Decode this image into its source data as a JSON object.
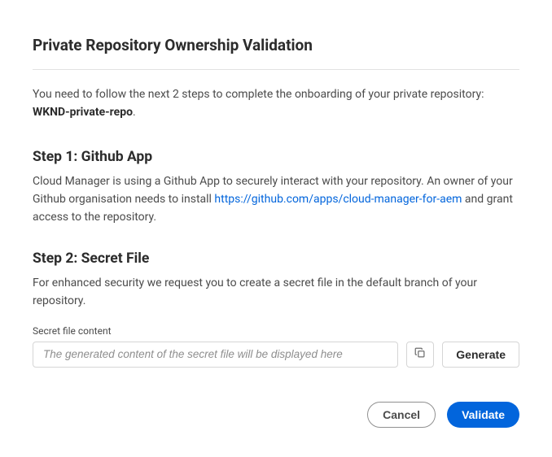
{
  "title": "Private Repository Ownership Validation",
  "intro": {
    "prefix": "You need to follow the next 2 steps to complete the onboarding of your private repository: ",
    "repo_name": "WKND-private-repo",
    "suffix": "."
  },
  "step1": {
    "heading": "Step 1: Github App",
    "body_prefix": "Cloud Manager is using a Github App to securely interact with your repository. An owner of your Github organisation needs to install ",
    "link_text": "https://github.com/apps/cloud-manager-for-aem",
    "body_suffix": " and grant access to the repository."
  },
  "step2": {
    "heading": "Step 2: Secret File",
    "body": "For enhanced security we request you to create a secret file in the default branch of your repository.",
    "field_label": "Secret file content",
    "placeholder": "The generated content of the secret file will be displayed here",
    "generate_label": "Generate"
  },
  "actions": {
    "cancel": "Cancel",
    "validate": "Validate"
  }
}
